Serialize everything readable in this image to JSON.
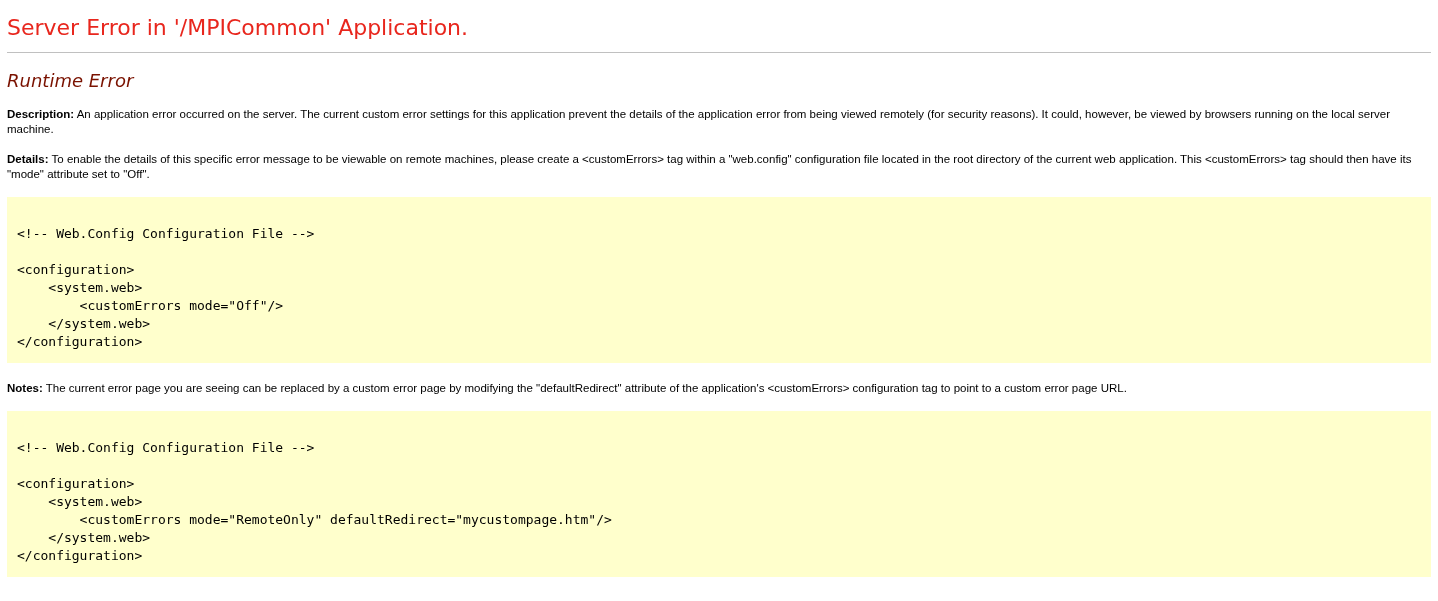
{
  "title": "Server Error in '/MPICommon' Application.",
  "subtitle": "Runtime Error",
  "sections": [
    {
      "kind": "paragraph",
      "text": "**Description:** An application error occurred on the server. The current custom error settings for this application prevent the details of the application error from being viewed remotely (for security reasons). It could, however, be viewed by browsers running on the local server machine."
    },
    {
      "kind": "paragraph",
      "text": "**Details:** To enable the details of this specific error message to be viewable on remote machines, please create a <customErrors> tag within a \"web.config\" configuration file located in the root directory of the current web application. This <customErrors> tag should then have its \"mode\" attribute set to \"Off\"."
    },
    {
      "kind": "code",
      "groups": [
        [
          "<!-- Web.Config Configuration File -->"
        ],
        [
          "<configuration>",
          "    <system.web>",
          "        <customErrors mode=\"Off\"/>",
          "    </system.web>",
          "</configuration>"
        ]
      ]
    },
    {
      "kind": "paragraph",
      "text": "**Notes:** The current error page you are seeing can be replaced by a custom error page by modifying the \"defaultRedirect\" attribute of the application's <customErrors> configuration tag to point to a custom error page URL."
    },
    {
      "kind": "code",
      "groups": [
        [
          "<!-- Web.Config Configuration File -->"
        ],
        [
          "<configuration>",
          "    <system.web>",
          "        <customErrors mode=\"RemoteOnly\" defaultRedirect=\"mycustompage.htm\"/>",
          "    </system.web>",
          "</configuration>"
        ]
      ]
    }
  ]
}
